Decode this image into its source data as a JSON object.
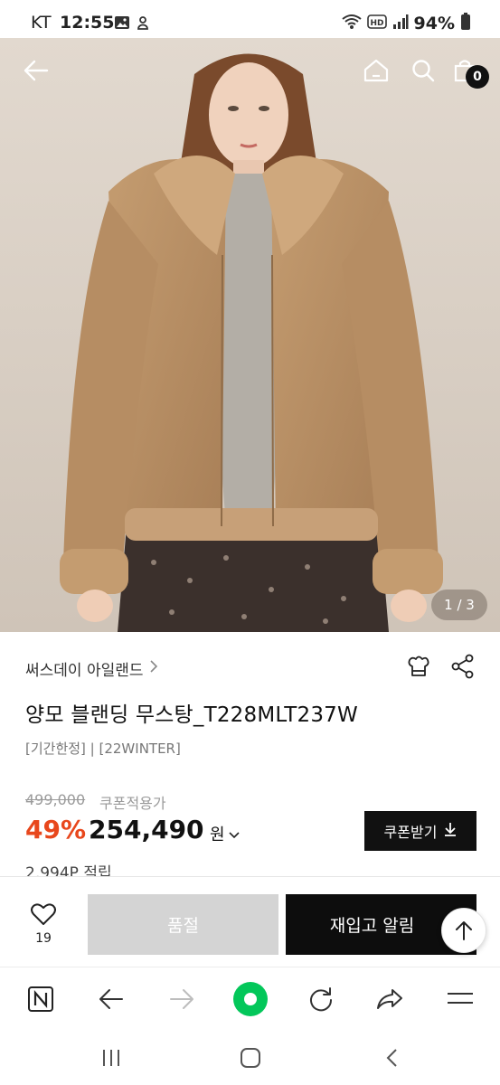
{
  "status_bar": {
    "carrier": "KT",
    "time": "12:55",
    "battery": "94%",
    "icons": [
      "image-icon",
      "alert-icon",
      "wifi-icon",
      "hd-icon",
      "signal-icon",
      "battery-icon"
    ]
  },
  "header": {
    "back_icon": "arrow-left-icon",
    "home_icon": "home-icon",
    "search_icon": "search-icon",
    "cart_icon": "shopping-bag-icon",
    "cart_count": "0"
  },
  "gallery": {
    "indicator": "1 / 3"
  },
  "product": {
    "brand": "써스데이 아일랜드",
    "brand_chevron": ">",
    "name": "양모 블랜딩 무스탕_T228MLT237W",
    "tags": "[기간한정] | [22WINTER]",
    "original_price": "499,000",
    "coupon_note": "쿠폰적용가",
    "discount": "49%",
    "price": "254,490",
    "currency": "원",
    "coupon_button": "쿠폰받기",
    "points": "2,994P 적립"
  },
  "purchase": {
    "wish_count": "19",
    "soldout_label": "품절",
    "restock_label": "재입고 알림"
  },
  "colors": {
    "discount": "#e8471c",
    "dark_button": "#0d0d0d",
    "disabled_button": "#d4d4d4",
    "naver_green": "#03c75a"
  }
}
